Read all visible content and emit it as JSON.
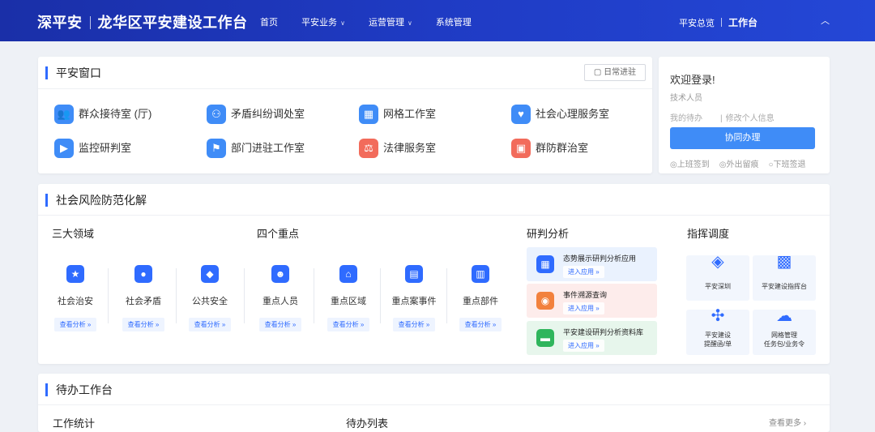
{
  "header": {
    "brand_left": "深平安",
    "brand_right": "龙华区平安建设工作台",
    "nav": [
      {
        "label": "首页",
        "caret": false
      },
      {
        "label": "平安业务",
        "caret": true
      },
      {
        "label": "运营管理",
        "caret": true
      },
      {
        "label": "系统管理",
        "caret": false
      }
    ],
    "overview": "平安总览",
    "workbench": "工作台",
    "collapse_glyph": "︿"
  },
  "window": {
    "title": "平安窗口",
    "daily_btn": "日常进驻",
    "items": [
      {
        "label": "群众接待室 (厅)",
        "glyph": "👥",
        "color": "#3f8cf7"
      },
      {
        "label": "矛盾纠纷调处室",
        "glyph": "⚇",
        "color": "#3f8cf7"
      },
      {
        "label": "网格工作室",
        "glyph": "▦",
        "color": "#3f8cf7"
      },
      {
        "label": "社会心理服务室",
        "glyph": "♥",
        "color": "#3f8cf7"
      },
      {
        "label": "监控研判室",
        "glyph": "▶",
        "color": "#3f8cf7"
      },
      {
        "label": "部门进驻工作室",
        "glyph": "⚑",
        "color": "#3f8cf7"
      },
      {
        "label": "法律服务室",
        "glyph": "⚖",
        "color": "#f26b5b"
      },
      {
        "label": "群防群治室",
        "glyph": "▣",
        "color": "#f26b5b"
      }
    ]
  },
  "welcome": {
    "title": "欢迎登录!",
    "role": "技术人员",
    "my_todo": "我的待办",
    "edit_info": "修改个人信息",
    "assist_btn": "协同办理",
    "checkins": [
      "◎上班签到",
      "◎外出留痕",
      "○下班签退"
    ]
  },
  "risk": {
    "title": "社会风险防范化解",
    "groups": [
      "三大领域",
      "四个重点",
      "研判分析",
      "指挥调度"
    ],
    "view_label": "查看分析 »",
    "items": [
      {
        "label": "社会治安",
        "glyph": "★"
      },
      {
        "label": "社会矛盾",
        "glyph": "●"
      },
      {
        "label": "公共安全",
        "glyph": "◆"
      },
      {
        "label": "重点人员",
        "glyph": "☻"
      },
      {
        "label": "重点区域",
        "glyph": "⌂"
      },
      {
        "label": "重点案事件",
        "glyph": "▤"
      },
      {
        "label": "重点部件",
        "glyph": "▥"
      }
    ],
    "analysis": [
      {
        "title": "态势展示研判分析应用",
        "enter": "进入应用 »",
        "bg": "#eaf2fe",
        "color": "#2f6bff",
        "glyph": "▦"
      },
      {
        "title": "事件溯源查询",
        "enter": "进入应用 »",
        "bg": "#fdeceb",
        "color": "#f2813d",
        "glyph": "◉"
      },
      {
        "title": "平安建设研判分析资料库",
        "enter": "进入应用 »",
        "bg": "#e7f6ec",
        "color": "#2fb55c",
        "glyph": "▬"
      }
    ],
    "command": [
      {
        "lines": [
          "平安深圳"
        ],
        "glyph": "◈"
      },
      {
        "lines": [
          "平安建设指挥台"
        ],
        "glyph": "▩"
      },
      {
        "lines": [
          "平安建设",
          "提醒函/单"
        ],
        "glyph": "✣"
      },
      {
        "lines": [
          "网格管理",
          "任务包/业务令"
        ],
        "glyph": "☁"
      }
    ]
  },
  "todo": {
    "title": "待办工作台",
    "stats": "工作统计",
    "list": "待办列表",
    "more": "查看更多 ›"
  }
}
